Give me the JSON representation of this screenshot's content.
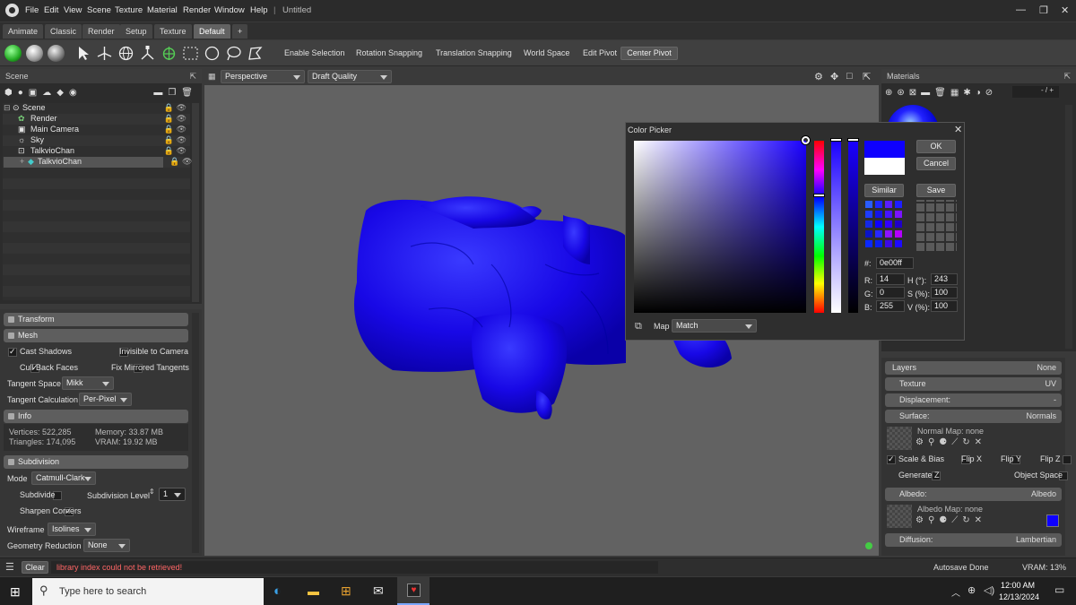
{
  "app": {
    "title": "Untitled"
  },
  "menu": [
    "File",
    "Edit",
    "View",
    "Scene",
    "Texture",
    "Material",
    "Render",
    "Window",
    "Help"
  ],
  "tabs": [
    "Animate",
    "Classic",
    "Render",
    "Setup",
    "Texture",
    "Default",
    "+"
  ],
  "toolbar": {
    "enable_selection": "Enable Selection",
    "rotation_snapping": "Rotation Snapping",
    "translation_snapping": "Translation Snapping",
    "world_space": "World Space",
    "edit_pivot": "Edit Pivot",
    "center_pivot": "Center Pivot"
  },
  "scene": {
    "title": "Scene",
    "items": [
      {
        "label": "Scene"
      },
      {
        "label": "Render"
      },
      {
        "label": "Main Camera"
      },
      {
        "label": "Sky"
      },
      {
        "label": "TalkvioChan"
      },
      {
        "label": "TalkvioChan"
      }
    ]
  },
  "props": {
    "transform": "Transform",
    "mesh": "Mesh",
    "cast_shadows": "Cast Shadows",
    "invisible_to_camera": "Invisible to Camera",
    "cull_back_faces": "Cull Back Faces",
    "fix_mirrored_tangents": "Fix Mirrored Tangents",
    "tangent_space_label": "Tangent Space",
    "tangent_space_value": "Mikk",
    "tangent_calc_label": "Tangent Calculation",
    "tangent_calc_value": "Per-Pixel",
    "info": "Info",
    "vertices": "Vertices: 522,285",
    "triangles": "Triangles: 174,095",
    "memory": "Memory: 33.87 MB",
    "vram": "VRAM: 19.92 MB",
    "subdivision": "Subdivision",
    "mode_label": "Mode",
    "mode_value": "Catmull-Clark",
    "subdivide": "Subdivide",
    "subdivision_level_label": "Subdivision Level",
    "subdivision_level_value": "1",
    "sharpen_corners": "Sharpen Corners",
    "wireframe_label": "Wireframe",
    "wireframe_value": "Isolines",
    "geometry_reduction_label": "Geometry Reduction",
    "geometry_reduction_value": "None"
  },
  "viewport": {
    "camera": "Perspective",
    "quality": "Draft Quality"
  },
  "color_picker": {
    "title": "Color Picker",
    "ok": "OK",
    "cancel": "Cancel",
    "similar": "Similar",
    "save": "Save",
    "hex_label": "#:",
    "hex": "0e00ff",
    "r_label": "R:",
    "r": "14",
    "g_label": "G:",
    "g": "0",
    "b_label": "B:",
    "b": "255",
    "h_label": "H (°):",
    "h": "243",
    "s_label": "S (%):",
    "s": "100",
    "v_label": "V (%):",
    "v": "100",
    "map_label": "Map",
    "map_value": "Match",
    "current_color": "#0e00ff"
  },
  "materials": {
    "title": "Materials",
    "counter": "- / +",
    "layers": "Layers",
    "layers_value": "None",
    "texture": "Texture",
    "texture_value": "UV",
    "displacement": "Displacement:",
    "displacement_value": "-",
    "surface": "Surface:",
    "surface_value": "Normals",
    "normal_map": "Normal Map: none",
    "scale_bias": "Scale & Bias",
    "flip_x": "Flip X",
    "flip_y": "Flip Y",
    "flip_z": "Flip Z",
    "generate_z": "Generate Z",
    "object_space": "Object Space",
    "albedo": "Albedo:",
    "albedo_value": "Albedo",
    "albedo_map": "Albedo Map: none",
    "diffusion": "Diffusion:",
    "diffusion_value": "Lambertian"
  },
  "status": {
    "clear": "Clear",
    "message": "library index could not be retrieved!",
    "autosave": "Autosave Done",
    "vram": "VRAM: 13%"
  },
  "taskbar": {
    "search_placeholder": "Type here to search",
    "time": "12:00 AM",
    "date": "12/13/2024"
  }
}
